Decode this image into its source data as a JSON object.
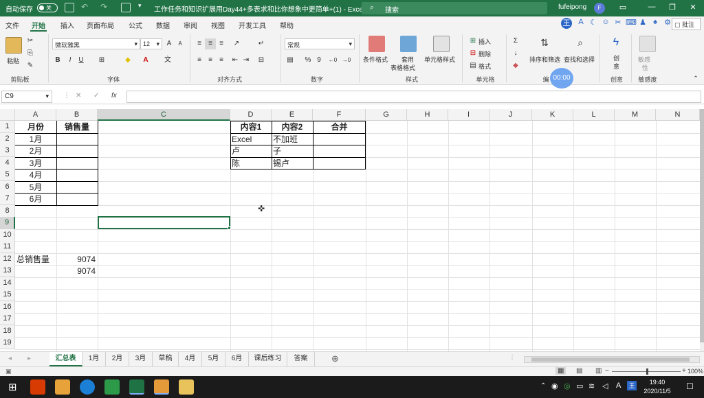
{
  "titlebar": {
    "autosave_label": "自动保存",
    "autosave_state": "关",
    "document_title": "工作任务和知识扩展用Day44+多表求和比你想象中更简单+(1)  -  Excel",
    "search_placeholder": "搜索",
    "user_name": "fufeipong",
    "avatar_initial": "F"
  },
  "menu": {
    "items": [
      "文件",
      "开始",
      "插入",
      "页面布局",
      "公式",
      "数据",
      "审阅",
      "视图",
      "开发工具",
      "帮助"
    ],
    "active": "开始",
    "comment_label": "批注"
  },
  "ribbon": {
    "clipboard": {
      "paste": "粘贴",
      "group": "剪贴板"
    },
    "font": {
      "name": "微软雅黑",
      "size": "12",
      "bold": "B",
      "italic": "I",
      "underline": "U",
      "group": "字体"
    },
    "alignment": {
      "group": "对齐方式"
    },
    "number": {
      "format": "常规",
      "percent": "%",
      "comma": "9",
      "group": "数字"
    },
    "styles": {
      "conditional": "条件格式",
      "table_format_1": "套用",
      "table_format_2": "表格格式",
      "cell_styles": "单元格样式",
      "group": "样式"
    },
    "cells": {
      "insert": "插入",
      "delete": "删除",
      "format": "格式",
      "group": "单元格"
    },
    "editing": {
      "sort_filter": "排序和筛选",
      "find_select": "查找和选择",
      "group_partial": "编"
    },
    "creative": {
      "label_1": "创",
      "label_2": "意",
      "group": "创意"
    },
    "sensitivity": {
      "label_1": "敏感",
      "label_2": "性",
      "group": "敏感度"
    },
    "timer": "00:00"
  },
  "formula_bar": {
    "name_box": "C9",
    "cancel": "✕",
    "enter": "✓",
    "fx": "fx",
    "content": ""
  },
  "grid": {
    "columns": [
      "A",
      "B",
      "C",
      "D",
      "E",
      "F",
      "G",
      "H",
      "I",
      "J",
      "K",
      "L",
      "M",
      "N"
    ],
    "rows": [
      "1",
      "2",
      "3",
      "4",
      "5",
      "6",
      "7",
      "8",
      "9",
      "10",
      "11",
      "12",
      "13",
      "14",
      "15",
      "16",
      "17",
      "18",
      "19"
    ],
    "selected_column": "C",
    "selected_row": "9",
    "A1": "月份",
    "B1": "销售量",
    "months": [
      "1月",
      "2月",
      "3月",
      "4月",
      "5月",
      "6月"
    ],
    "D1": "内容1",
    "E1": "内容2",
    "F1": "合并",
    "D2": "Excel",
    "E2": "不加班",
    "D3": "卢",
    "E3": "子",
    "D4": "陈",
    "E4": "锡卢",
    "A12": "总销售量",
    "B12": "9074",
    "B13": "9074"
  },
  "sheet_tabs": [
    "汇总表",
    "1月",
    "2月",
    "3月",
    "草稿",
    "4月",
    "5月",
    "6月",
    "课后练习",
    "答案"
  ],
  "active_sheet": "汇总表",
  "status": {
    "zoom": "100%"
  },
  "taskbar": {
    "time": "19:40",
    "date": "2020/11/5",
    "ime": "A"
  }
}
